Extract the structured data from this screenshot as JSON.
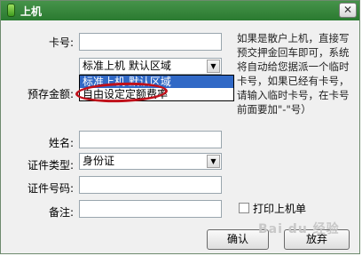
{
  "window": {
    "title": "上机",
    "close_glyph": "✕"
  },
  "form": {
    "card_no_label": "卡号:",
    "deposit_label": "预存金额:",
    "name_label": "姓名:",
    "id_type_label": "证件类型:",
    "id_no_label": "证件号码:",
    "note_label": "备注:",
    "mode_select_value": "标准上机   默认区域",
    "id_type_value": "身份证"
  },
  "dropdown": {
    "options": [
      "标准上机   默认区域",
      "自由设定定额费率"
    ]
  },
  "info_text": "如果是散户上机，直接写预交押金回车即可，系统将自动给您据派一个临时卡号，如果已经有卡号，请输入临时卡号，在卡号前面要加\"-\"号）",
  "print_checkbox_label": "打印上机单",
  "buttons": {
    "confirm": "确认",
    "cancel": "放弃"
  },
  "watermark": "Bai du 经验"
}
